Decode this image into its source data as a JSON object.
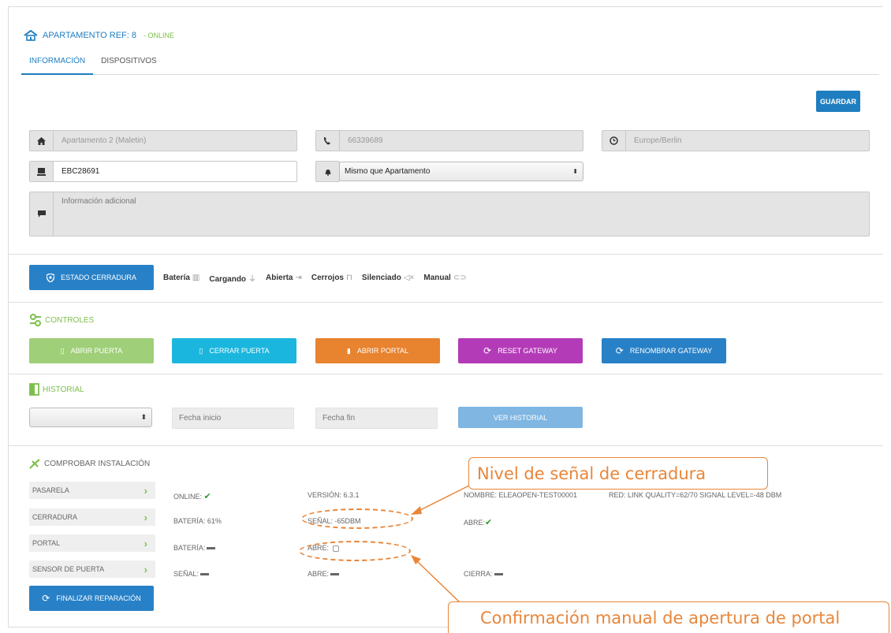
{
  "header": {
    "title": "APARTAMENTO REF: 8",
    "status": "- ONLINE"
  },
  "tabs": [
    {
      "label": "INFORMACIÓN"
    },
    {
      "label": "DISPOSITIVOS"
    }
  ],
  "save_label": "GUARDAR",
  "fields": {
    "name": "Apartamento 2 (Maletin)",
    "phone": "66339689",
    "timezone": "Europe/Berlin",
    "code": "EBC28691",
    "alarm_select": "Mismo que Apartamento",
    "info_placeholder": "Información adicional"
  },
  "lock_status": {
    "button": "ESTADO CERRADURA",
    "items": [
      "Batería",
      "Cargando",
      "Abierta",
      "Cerrojos",
      "Silenciado",
      "Manual"
    ]
  },
  "controls": {
    "title": "CONTROLES",
    "buttons": [
      {
        "label": "ABRIR PUERTA",
        "color": "#9fcf78"
      },
      {
        "label": "CERRAR PUERTA",
        "color": "#1bb6dd"
      },
      {
        "label": "ABRIR PORTAL",
        "color": "#e8832f"
      },
      {
        "label": "RESET GATEWAY",
        "color": "#b43bb8"
      },
      {
        "label": "RENOMBRAR GATEWAY",
        "color": "#2881c7"
      }
    ]
  },
  "history": {
    "title": "HISTORIAL",
    "start_placeholder": "Fecha inicio",
    "end_placeholder": "Fecha fin",
    "button": "VER HISTORIAL"
  },
  "check": {
    "title": "COMPROBAR INSTALACIÓN",
    "rows": [
      {
        "label": "PASARELA",
        "c1": "ONLINE:",
        "c2": "VERSIÓN: 6.3.1",
        "c3": "NOMBRE: ELEAOPEN-TEST00001",
        "c4": "RED: LINK QUALITY=62/70 SIGNAL LEVEL=-48 DBM"
      },
      {
        "label": "CERRADURA",
        "c1": "BATERÍA: 61%",
        "c2": "SEÑAL: -65DBM",
        "c3": "ABRE:"
      },
      {
        "label": "PORTAL",
        "c1": "BATERÍA:",
        "c2": "ABRE:"
      },
      {
        "label": "SENSOR DE PUERTA",
        "c1": "SEÑAL:",
        "c2": "ABRE:",
        "c3": "CIERRA:"
      }
    ],
    "finish_button": "FINALIZAR REPARACIÓN"
  },
  "annotations": {
    "signal": "Nivel de señal de cerradura",
    "manual": "Confirmación manual de apertura de portal"
  }
}
